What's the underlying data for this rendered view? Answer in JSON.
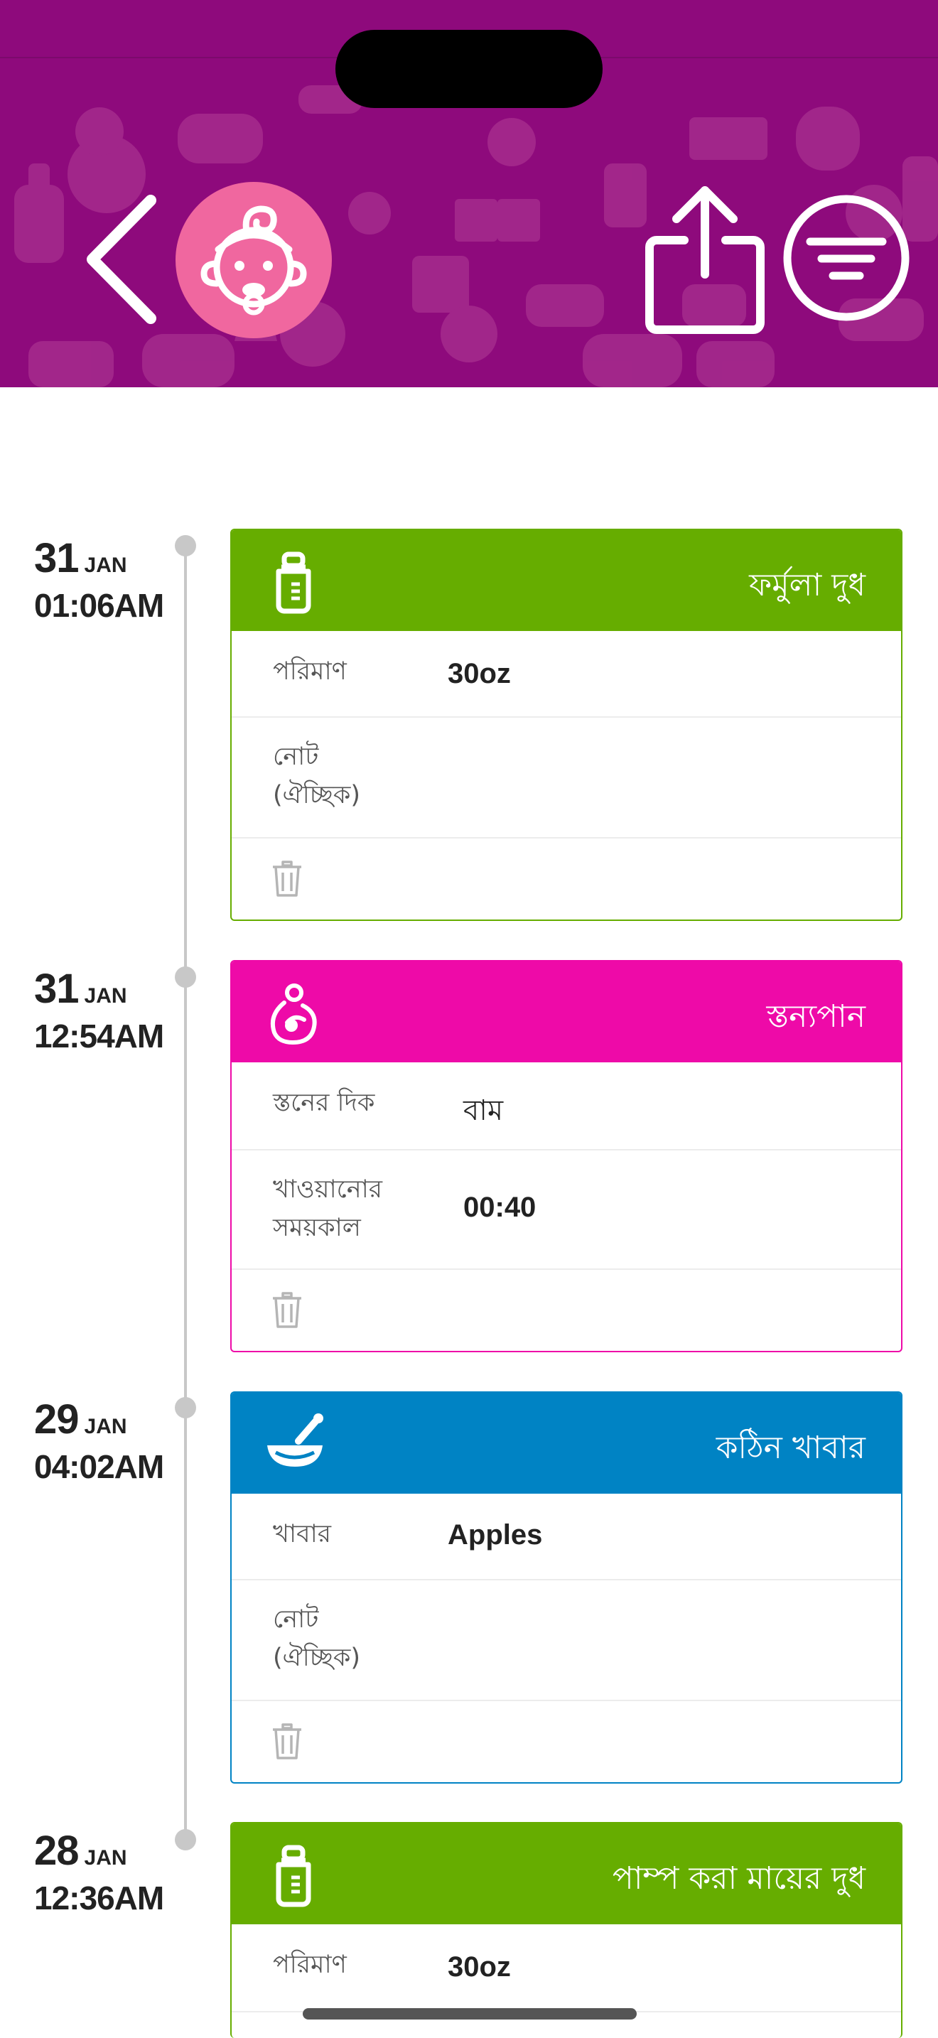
{
  "header": {
    "back_icon": "chevron-left-icon",
    "avatar_icon": "baby-face-icon",
    "share_icon": "share-icon",
    "filter_icon": "filter-icon",
    "background_color": "#8e0a7c",
    "avatar_color": "#f0679f"
  },
  "entries": [
    {
      "day": "31",
      "month": "JAN",
      "time": "01:06AM",
      "title": "ফর্মুলা দুধ",
      "icon": "bottle-icon",
      "color": "#66ad00",
      "rows": [
        {
          "label": "পরিমাণ",
          "value": "30oz"
        },
        {
          "label": "নোট (ঐচ্ছিক)",
          "value": ""
        }
      ]
    },
    {
      "day": "31",
      "month": "JAN",
      "time": "12:54AM",
      "title": "স্তন্যপান",
      "icon": "breastfeeding-icon",
      "color": "#ee0aa8",
      "rows": [
        {
          "label": "স্তনের দিক",
          "value": "বাম"
        },
        {
          "label": "খাওয়ানোর সময়কাল",
          "value": "00:40"
        }
      ]
    },
    {
      "day": "29",
      "month": "JAN",
      "time": "04:02AM",
      "title": "কঠিন খাবার",
      "icon": "mortar-bowl-icon",
      "color": "#0083c4",
      "rows": [
        {
          "label": "খাবার",
          "value": "Apples"
        },
        {
          "label": "নোট (ঐচ্ছিক)",
          "value": ""
        }
      ]
    },
    {
      "day": "28",
      "month": "JAN",
      "time": "12:36AM",
      "title": "পাম্প করা মায়ের দুধ",
      "icon": "bottle-icon",
      "color": "#66ad00",
      "rows": [
        {
          "label": "পরিমাণ",
          "value": "30oz"
        }
      ]
    }
  ],
  "delete_icon": "trash-icon"
}
